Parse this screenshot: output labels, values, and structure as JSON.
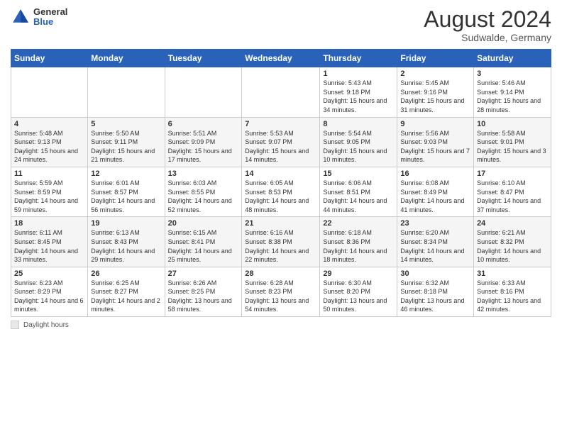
{
  "header": {
    "logo_general": "General",
    "logo_blue": "Blue",
    "month_title": "August 2024",
    "subtitle": "Sudwalde, Germany"
  },
  "days_of_week": [
    "Sunday",
    "Monday",
    "Tuesday",
    "Wednesday",
    "Thursday",
    "Friday",
    "Saturday"
  ],
  "footer": {
    "label": "Daylight hours"
  },
  "weeks": [
    [
      {
        "day": "",
        "sunrise": "",
        "sunset": "",
        "daylight": ""
      },
      {
        "day": "",
        "sunrise": "",
        "sunset": "",
        "daylight": ""
      },
      {
        "day": "",
        "sunrise": "",
        "sunset": "",
        "daylight": ""
      },
      {
        "day": "",
        "sunrise": "",
        "sunset": "",
        "daylight": ""
      },
      {
        "day": "1",
        "sunrise": "Sunrise: 5:43 AM",
        "sunset": "Sunset: 9:18 PM",
        "daylight": "Daylight: 15 hours and 34 minutes."
      },
      {
        "day": "2",
        "sunrise": "Sunrise: 5:45 AM",
        "sunset": "Sunset: 9:16 PM",
        "daylight": "Daylight: 15 hours and 31 minutes."
      },
      {
        "day": "3",
        "sunrise": "Sunrise: 5:46 AM",
        "sunset": "Sunset: 9:14 PM",
        "daylight": "Daylight: 15 hours and 28 minutes."
      }
    ],
    [
      {
        "day": "4",
        "sunrise": "Sunrise: 5:48 AM",
        "sunset": "Sunset: 9:13 PM",
        "daylight": "Daylight: 15 hours and 24 minutes."
      },
      {
        "day": "5",
        "sunrise": "Sunrise: 5:50 AM",
        "sunset": "Sunset: 9:11 PM",
        "daylight": "Daylight: 15 hours and 21 minutes."
      },
      {
        "day": "6",
        "sunrise": "Sunrise: 5:51 AM",
        "sunset": "Sunset: 9:09 PM",
        "daylight": "Daylight: 15 hours and 17 minutes."
      },
      {
        "day": "7",
        "sunrise": "Sunrise: 5:53 AM",
        "sunset": "Sunset: 9:07 PM",
        "daylight": "Daylight: 15 hours and 14 minutes."
      },
      {
        "day": "8",
        "sunrise": "Sunrise: 5:54 AM",
        "sunset": "Sunset: 9:05 PM",
        "daylight": "Daylight: 15 hours and 10 minutes."
      },
      {
        "day": "9",
        "sunrise": "Sunrise: 5:56 AM",
        "sunset": "Sunset: 9:03 PM",
        "daylight": "Daylight: 15 hours and 7 minutes."
      },
      {
        "day": "10",
        "sunrise": "Sunrise: 5:58 AM",
        "sunset": "Sunset: 9:01 PM",
        "daylight": "Daylight: 15 hours and 3 minutes."
      }
    ],
    [
      {
        "day": "11",
        "sunrise": "Sunrise: 5:59 AM",
        "sunset": "Sunset: 8:59 PM",
        "daylight": "Daylight: 14 hours and 59 minutes."
      },
      {
        "day": "12",
        "sunrise": "Sunrise: 6:01 AM",
        "sunset": "Sunset: 8:57 PM",
        "daylight": "Daylight: 14 hours and 56 minutes."
      },
      {
        "day": "13",
        "sunrise": "Sunrise: 6:03 AM",
        "sunset": "Sunset: 8:55 PM",
        "daylight": "Daylight: 14 hours and 52 minutes."
      },
      {
        "day": "14",
        "sunrise": "Sunrise: 6:05 AM",
        "sunset": "Sunset: 8:53 PM",
        "daylight": "Daylight: 14 hours and 48 minutes."
      },
      {
        "day": "15",
        "sunrise": "Sunrise: 6:06 AM",
        "sunset": "Sunset: 8:51 PM",
        "daylight": "Daylight: 14 hours and 44 minutes."
      },
      {
        "day": "16",
        "sunrise": "Sunrise: 6:08 AM",
        "sunset": "Sunset: 8:49 PM",
        "daylight": "Daylight: 14 hours and 41 minutes."
      },
      {
        "day": "17",
        "sunrise": "Sunrise: 6:10 AM",
        "sunset": "Sunset: 8:47 PM",
        "daylight": "Daylight: 14 hours and 37 minutes."
      }
    ],
    [
      {
        "day": "18",
        "sunrise": "Sunrise: 6:11 AM",
        "sunset": "Sunset: 8:45 PM",
        "daylight": "Daylight: 14 hours and 33 minutes."
      },
      {
        "day": "19",
        "sunrise": "Sunrise: 6:13 AM",
        "sunset": "Sunset: 8:43 PM",
        "daylight": "Daylight: 14 hours and 29 minutes."
      },
      {
        "day": "20",
        "sunrise": "Sunrise: 6:15 AM",
        "sunset": "Sunset: 8:41 PM",
        "daylight": "Daylight: 14 hours and 25 minutes."
      },
      {
        "day": "21",
        "sunrise": "Sunrise: 6:16 AM",
        "sunset": "Sunset: 8:38 PM",
        "daylight": "Daylight: 14 hours and 22 minutes."
      },
      {
        "day": "22",
        "sunrise": "Sunrise: 6:18 AM",
        "sunset": "Sunset: 8:36 PM",
        "daylight": "Daylight: 14 hours and 18 minutes."
      },
      {
        "day": "23",
        "sunrise": "Sunrise: 6:20 AM",
        "sunset": "Sunset: 8:34 PM",
        "daylight": "Daylight: 14 hours and 14 minutes."
      },
      {
        "day": "24",
        "sunrise": "Sunrise: 6:21 AM",
        "sunset": "Sunset: 8:32 PM",
        "daylight": "Daylight: 14 hours and 10 minutes."
      }
    ],
    [
      {
        "day": "25",
        "sunrise": "Sunrise: 6:23 AM",
        "sunset": "Sunset: 8:29 PM",
        "daylight": "Daylight: 14 hours and 6 minutes."
      },
      {
        "day": "26",
        "sunrise": "Sunrise: 6:25 AM",
        "sunset": "Sunset: 8:27 PM",
        "daylight": "Daylight: 14 hours and 2 minutes."
      },
      {
        "day": "27",
        "sunrise": "Sunrise: 6:26 AM",
        "sunset": "Sunset: 8:25 PM",
        "daylight": "Daylight: 13 hours and 58 minutes."
      },
      {
        "day": "28",
        "sunrise": "Sunrise: 6:28 AM",
        "sunset": "Sunset: 8:23 PM",
        "daylight": "Daylight: 13 hours and 54 minutes."
      },
      {
        "day": "29",
        "sunrise": "Sunrise: 6:30 AM",
        "sunset": "Sunset: 8:20 PM",
        "daylight": "Daylight: 13 hours and 50 minutes."
      },
      {
        "day": "30",
        "sunrise": "Sunrise: 6:32 AM",
        "sunset": "Sunset: 8:18 PM",
        "daylight": "Daylight: 13 hours and 46 minutes."
      },
      {
        "day": "31",
        "sunrise": "Sunrise: 6:33 AM",
        "sunset": "Sunset: 8:16 PM",
        "daylight": "Daylight: 13 hours and 42 minutes."
      }
    ]
  ]
}
